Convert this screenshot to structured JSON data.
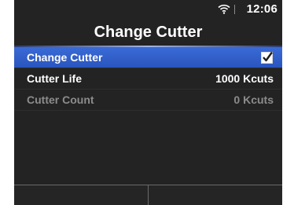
{
  "status_bar": {
    "time": "12:06",
    "wifi_icon": "wifi-icon"
  },
  "header": {
    "title": "Change Cutter"
  },
  "menu": {
    "items": [
      {
        "label": "Change Cutter",
        "value": "",
        "checked": true,
        "selected": true,
        "enabled": true
      },
      {
        "label": "Cutter Life",
        "value": "1000 Kcuts",
        "selected": false,
        "enabled": true
      },
      {
        "label": "Cutter Count",
        "value": "0 Kcuts",
        "selected": false,
        "enabled": false
      }
    ]
  },
  "colors": {
    "background": "#232323",
    "selection": "#2f5ecb",
    "text": "#ffffff",
    "disabled_text": "#8c8c8c"
  }
}
